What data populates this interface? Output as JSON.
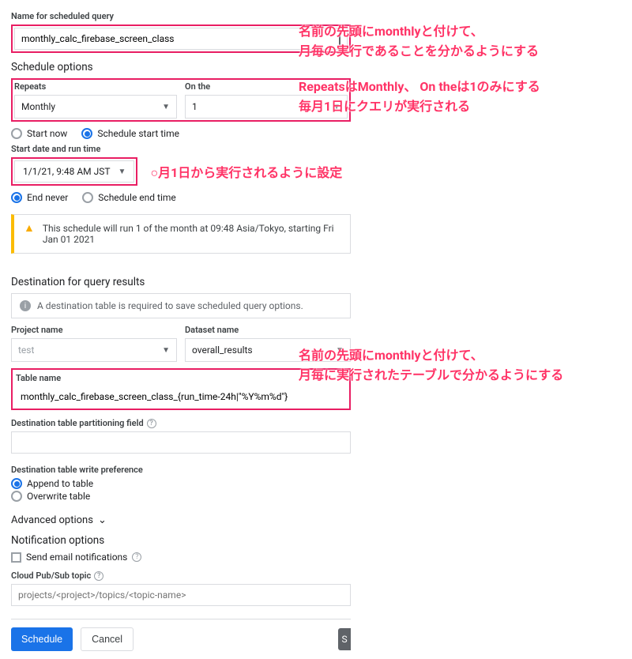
{
  "nameField": {
    "label": "Name for scheduled query",
    "value": "monthly_calc_firebase_screen_class"
  },
  "scheduleOptions": {
    "title": "Schedule options",
    "repeats": {
      "label": "Repeats",
      "value": "Monthly"
    },
    "onThe": {
      "label": "On the",
      "value": "1"
    },
    "startNow": "Start now",
    "scheduleStart": "Schedule start time"
  },
  "startDate": {
    "label": "Start date and run time",
    "value": "1/1/21, 9:48 AM JST"
  },
  "endOpts": {
    "endNever": "End never",
    "scheduleEnd": "Schedule end time"
  },
  "banner": "This schedule will run 1 of the month at 09:48 Asia/Tokyo, starting Fri Jan 01 2021",
  "destination": {
    "title": "Destination for query results",
    "note": "A destination table is required to save scheduled query options.",
    "project": {
      "label": "Project name",
      "value": "test"
    },
    "dataset": {
      "label": "Dataset name",
      "value": "overall_results"
    },
    "table": {
      "label": "Table name",
      "value": "monthly_calc_firebase_screen_class_{run_time-24h|\"%Y%m%d\"}"
    },
    "partition": {
      "label": "Destination table partitioning field"
    }
  },
  "writePref": {
    "label": "Destination table write preference",
    "append": "Append to table",
    "overwrite": "Overwrite table"
  },
  "advanced": "Advanced options",
  "notification": {
    "title": "Notification options",
    "email": "Send email notifications",
    "pubsub": {
      "label": "Cloud Pub/Sub topic",
      "placeholder": "projects/<project>/topics/<topic-name>"
    }
  },
  "buttons": {
    "schedule": "Schedule",
    "cancel": "Cancel",
    "s": "S"
  },
  "annotations": {
    "a1_l1": "名前の先頭にmonthlyと付けて、",
    "a1_l2": "月毎の実行であることを分かるようにする",
    "a2_l1": "RepeatsはMonthly、 On theは1のみにする",
    "a2_l2": "毎月1日にクエリが実行される",
    "a3": "○月1日から実行されるように設定",
    "a4_l1": "名前の先頭にmonthlyと付けて、",
    "a4_l2": "月毎に実行されたテーブルで分かるようにする"
  }
}
